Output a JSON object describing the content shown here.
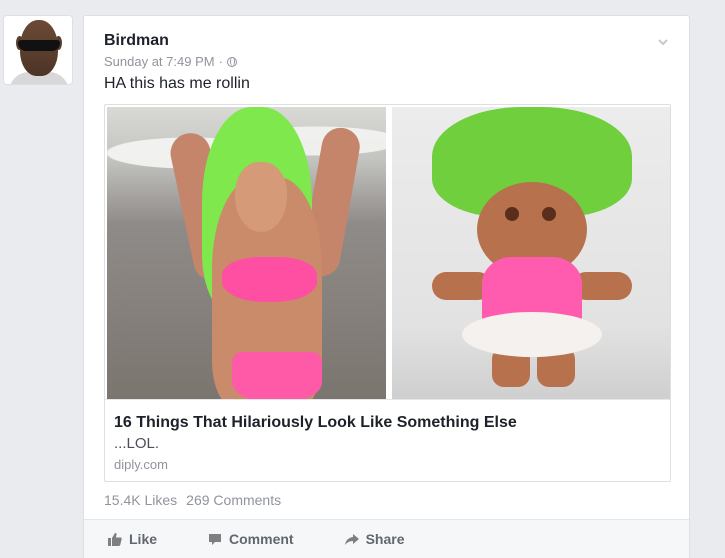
{
  "post": {
    "author": "Birdman",
    "timestamp": "Sunday at 7:49 PM",
    "separator": "·",
    "text": "HA this has me rollin",
    "privacy_icon": "globe-icon",
    "options_icon": "chevron-down-icon"
  },
  "link_preview": {
    "title": "16 Things That Hilariously Look Like Something Else",
    "description": "...LOL.",
    "domain": "diply.com"
  },
  "stats": {
    "likes": "15.4K Likes",
    "comments": "269 Comments"
  },
  "actions": [
    {
      "label": "Like",
      "icon": "thumbs-up-icon"
    },
    {
      "label": "Comment",
      "icon": "comment-icon"
    },
    {
      "label": "Share",
      "icon": "share-icon"
    }
  ],
  "colors": {
    "page_bg": "#e9ebee",
    "card_bg": "#ffffff",
    "meta_gray": "#90949c",
    "action_gray": "#616770"
  }
}
